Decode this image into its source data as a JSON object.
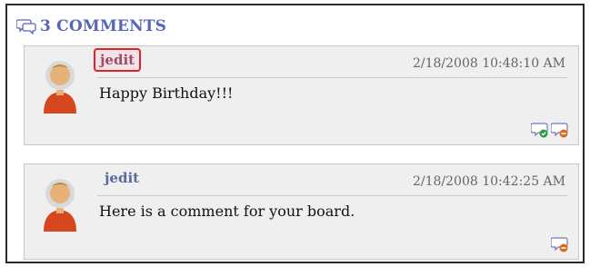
{
  "header": {
    "title": "3 COMMENTS",
    "icon": "comments-icon"
  },
  "comments": [
    {
      "author": "jedit",
      "timestamp": "2/18/2008 10:48:10 AM",
      "text": "Happy Birthday!!!",
      "actions": [
        "approve-comment-icon",
        "delete-comment-icon"
      ]
    },
    {
      "author": "jedit",
      "timestamp": "2/18/2008 10:42:25 AM",
      "text": "Here is a comment for your board.",
      "actions": [
        "delete-comment-icon"
      ]
    }
  ],
  "colors": {
    "accent": "#5566bb",
    "highlight": "#e0202a",
    "panel": "#efefef",
    "approve": "#2e9e3a",
    "delete": "#e06a1a"
  }
}
